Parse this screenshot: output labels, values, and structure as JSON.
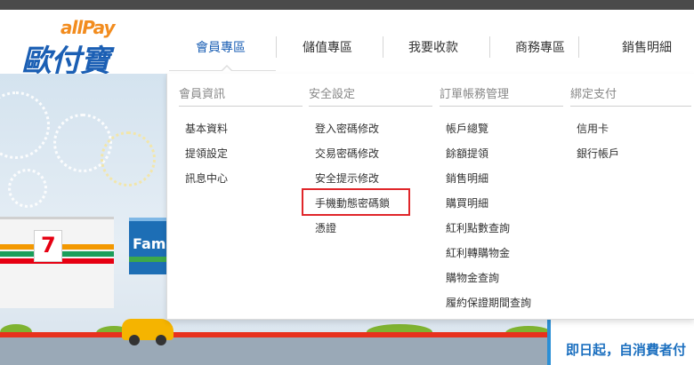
{
  "logo": {
    "brand": "allPay",
    "name_zh": "歐付寶"
  },
  "nav": {
    "items": [
      {
        "label": "會員專區",
        "active": true
      },
      {
        "label": "儲值專區",
        "active": false
      },
      {
        "label": "我要收款",
        "active": false
      },
      {
        "label": "商務專區",
        "active": false
      },
      {
        "label": "銷售明細",
        "active": false
      }
    ]
  },
  "dropdown": {
    "columns": [
      {
        "title": "會員資訊",
        "items": [
          "基本資料",
          "提領設定",
          "訊息中心"
        ]
      },
      {
        "title": "安全設定",
        "items": [
          "登入密碼修改",
          "交易密碼修改",
          "安全提示修改",
          "手機動態密碼鎖",
          "憑證"
        ]
      },
      {
        "title": "訂單帳務管理",
        "items": [
          "帳戶總覽",
          "餘額提領",
          "銷售明細",
          "購買明細",
          "紅利點數查詢",
          "紅利轉購物金",
          "購物金查詢",
          "履約保證期間查詢"
        ]
      },
      {
        "title": "綁定支付",
        "items": [
          "信用卡",
          "銀行帳戶"
        ]
      }
    ],
    "highlighted_item": "手機動態密碼鎖"
  },
  "banner": {
    "store_left": "7-ELEVEN",
    "store_right": "Fam",
    "promo_text": "即日起，自消費者付"
  },
  "colors": {
    "brand_blue": "#1b5fb4",
    "brand_orange": "#f28c1e",
    "highlight_red": "#e0262a",
    "topbar": "#4a4a4a"
  }
}
